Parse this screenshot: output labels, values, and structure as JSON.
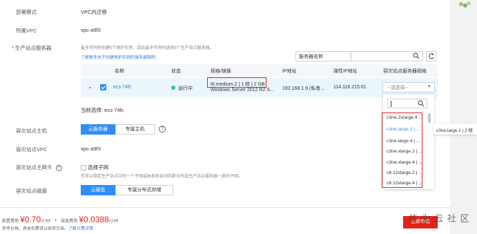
{
  "form": {
    "deploy_mode_label": "部署模式",
    "deploy_mode_value": "VPC内迁移",
    "vpc_label": "所属VPC",
    "vpc_value": "vpc-a9f3",
    "prod_server_label": "生产站点服务器",
    "prod_server_hint": "最多可同时创建5个保护实例，因此最多可同时选择5个生产站点服务器。",
    "prod_server_link": "了解更多关于创建保护实例的服务器限制",
    "search_category": "服务器名称",
    "current_selection": "当前选择: ecs-74fc",
    "dr_host_label": "容灾站点主机",
    "dr_host_tab_cloud": "云服务器",
    "dr_host_tab_dedicated": "专属主机",
    "dr_vpc_label": "容灾站点VPC",
    "dr_vpc_value": "vpc-a9f3",
    "dr_nic_label": "容灾站点主网卡",
    "dr_nic_option": "选择子网",
    "dr_nic_hint": "您可以指定生产站点中的一个子网或由系统自动匹配与所选生产站点服务器一致的子网。",
    "dr_disk_label": "容灾站点磁盘",
    "dr_disk_tab_cloud": "云硬盘",
    "dr_disk_tab_dedicated": "专属分布式存储"
  },
  "table": {
    "headers": [
      "名称",
      "状态",
      "规格/镜像",
      "IP地址",
      "弹性IP地址",
      "容灾站点服务器规格"
    ],
    "row": {
      "name": "ecs-74fc",
      "status": "运行中",
      "spec": "t6.medium.2 | 1 核 | 2 GB",
      "image": "Windows Server 2012 R2 S...",
      "ip": "192.168.1.9 (私有...",
      "eip": "114.116.215.61",
      "dr_spec_placeholder": "--请选择--"
    }
  },
  "dropdown": {
    "items": [
      "c3ne.2xlarge.4 ...",
      "c3ne.large.2 | ...",
      "c3ne.large.4 | ...",
      "c3ne.xlarge.2 | ...",
      "c3ne.xlarge.4 | ...",
      "c6.12xlarge.2 | ...",
      "c6.12xlarge.4 | ..."
    ],
    "tooltip": "c3ne.large.2 | 2 核"
  },
  "footer": {
    "config_fee_label": "配置费用",
    "config_fee_value": "¥0.70",
    "config_fee_unit": "/小时",
    "plus": "+",
    "disk_fee_label": "磁盘费用",
    "disk_fee_value": "¥0.0388",
    "disk_fee_unit": "/小时",
    "note": "参考价格，具体扣费请以账单为准。",
    "note_link": "了解计费详情",
    "submit": "立即申请",
    "watermark": "华 为 云 社 区"
  },
  "colors": {
    "accent": "#2f8df7",
    "danger": "#e0231a",
    "price": "#e0231a",
    "running": "#3dbf8a"
  }
}
